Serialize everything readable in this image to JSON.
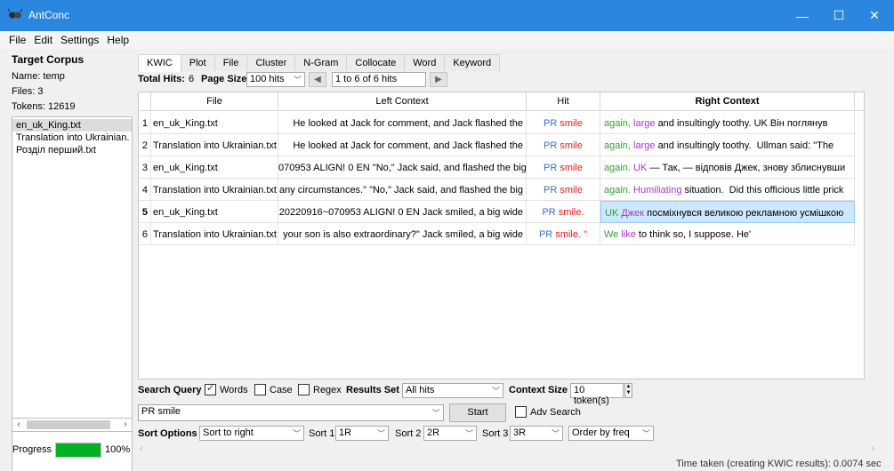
{
  "window": {
    "title": "AntConc",
    "minimize_glyph": "—",
    "maximize_glyph": "☐",
    "close_glyph": "✕"
  },
  "menu": [
    "File",
    "Edit",
    "Settings",
    "Help"
  ],
  "left_panel": {
    "title": "Target Corpus",
    "name_line": "Name:  temp",
    "files_line": "Files:   3",
    "tokens_line": "Tokens: 12619",
    "files": [
      "en_uk_King.txt",
      "Translation into Ukrainian.",
      "Розділ перший.txt"
    ],
    "selected_index": 0,
    "scroll_left": "‹",
    "scroll_right": "›"
  },
  "progress": {
    "label": "Progress",
    "value": 100,
    "text": "100%"
  },
  "tabs": [
    "KWIC",
    "Plot",
    "File",
    "Cluster",
    "N-Gram",
    "Collocate",
    "Word",
    "Keyword"
  ],
  "hits_bar": {
    "total_hits_label": "Total Hits:",
    "total_hits_value": "6",
    "page_size_label": "Page Size",
    "page_size_value": "100 hits",
    "prev_icon": "◀",
    "next_icon": "▶",
    "page_range": "1 to 6 of 6 hits"
  },
  "table": {
    "headers": [
      "File",
      "Left Context",
      "Hit",
      "Right Context"
    ],
    "rows": [
      {
        "n": "1",
        "file": "en_uk_King.txt",
        "left": "He looked at Jack for comment, and Jack flashed the",
        "hit_pos": "PR",
        "hit_word": "smile",
        "hit_extra": "",
        "right": [
          {
            "t": "again, ",
            "c": "green"
          },
          {
            "t": "large ",
            "c": "purple"
          },
          {
            "t": "and insultingly toothy. UK Він поглянув",
            "c": "black"
          }
        ]
      },
      {
        "n": "2",
        "file": "Translation into Ukrainian.txt",
        "left": "He looked at Jack for comment, and Jack flashed the",
        "hit_pos": "PR",
        "hit_word": "smile",
        "hit_extra": "",
        "right": [
          {
            "t": "again, ",
            "c": "green"
          },
          {
            "t": "large ",
            "c": "purple"
          },
          {
            "t": "and insultingly toothy.  Ullman said: \"The",
            "c": "black"
          }
        ]
      },
      {
        "n": "3",
        "file": "en_uk_King.txt",
        "left": "070953 ALIGN! 0 EN \"No,\" Jack said, and flashed the big",
        "hit_pos": "PR",
        "hit_word": "smile",
        "hit_extra": "",
        "right": [
          {
            "t": "again. ",
            "c": "green"
          },
          {
            "t": "UK ",
            "c": "purple"
          },
          {
            "t": "— Так, — відповів Джек, знову зблиснувши",
            "c": "black"
          }
        ]
      },
      {
        "n": "4",
        "file": "Translation into Ukrainian.txt",
        "left": "any circumstances.\" \"No,\" Jack said, and flashed the big",
        "hit_pos": "PR",
        "hit_word": "smile",
        "hit_extra": "",
        "right": [
          {
            "t": "again. ",
            "c": "green"
          },
          {
            "t": "Humiliating ",
            "c": "purple"
          },
          {
            "t": "situation.  Did this officious little prick",
            "c": "black"
          }
        ]
      },
      {
        "n": "5",
        "file": "en_uk_King.txt",
        "left": "20220916~070953 ALIGN! 0 EN Jack smiled, a big wide",
        "hit_pos": "PR",
        "hit_word": "smile.",
        "hit_extra": "",
        "right": [
          {
            "t": "UK ",
            "c": "green"
          },
          {
            "t": "Джек ",
            "c": "purple"
          },
          {
            "t": "посміхнувся великою рекламною усмішкою",
            "c": "black"
          }
        ]
      },
      {
        "n": "6",
        "file": "Translation into Ukrainian.txt",
        "left": "your son is also extraordinary?\" Jack smiled, a big wide",
        "hit_pos": "PR",
        "hit_word": "smile.",
        "hit_extra": " \"",
        "right": [
          {
            "t": "We ",
            "c": "green"
          },
          {
            "t": "like ",
            "c": "purple"
          },
          {
            "t": "to think so, I suppose. He'",
            "c": "black"
          }
        ]
      }
    ],
    "bold_row_number": "5",
    "selected_right_row": "5"
  },
  "search_bar": {
    "search_query_label": "Search Query",
    "words_label": "Words",
    "words_checked": true,
    "case_label": "Case",
    "case_checked": false,
    "regex_label": "Regex",
    "regex_checked": false,
    "results_set_label": "Results Set",
    "results_set_value": "All hits",
    "context_size_label": "Context Size",
    "context_size_value": "10 token(s)",
    "query_value": "PR smile",
    "start_label": "Start",
    "adv_search_label": "Adv Search",
    "adv_search_checked": false
  },
  "sort_bar": {
    "label": "Sort Options",
    "sort_to": "Sort to right",
    "sort1_label": "Sort 1",
    "sort1_value": "1R",
    "sort2_label": "Sort 2",
    "sort2_value": "2R",
    "sort3_label": "Sort 3",
    "sort3_value": "3R",
    "order_value": "Order by freq"
  },
  "status_text": "Time taken (creating KWIC results): 0.0074 sec",
  "colors": {
    "titlebar": "#2b86e0",
    "hit_pos": "#3a6fd3",
    "hit_word": "#e02020",
    "green": "#2ea02e",
    "purple": "#a43ac9",
    "progress": "#06b025",
    "selected_cell": "#cce8ff"
  }
}
